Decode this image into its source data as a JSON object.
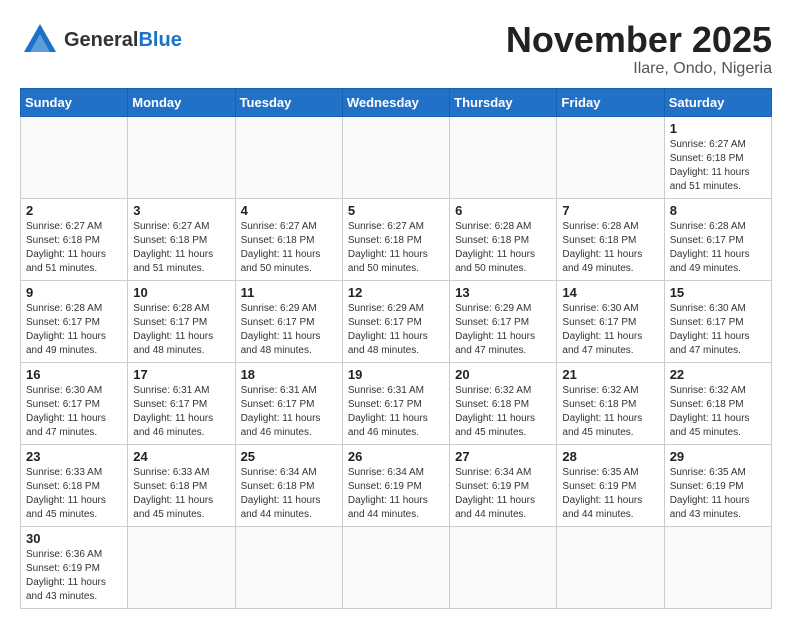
{
  "header": {
    "logo": {
      "general": "General",
      "blue": "Blue"
    },
    "title": "November 2025",
    "location": "Ilare, Ondo, Nigeria"
  },
  "weekdays": [
    "Sunday",
    "Monday",
    "Tuesday",
    "Wednesday",
    "Thursday",
    "Friday",
    "Saturday"
  ],
  "weeks": [
    [
      null,
      null,
      null,
      null,
      null,
      null,
      {
        "day": "1",
        "sunrise": "6:27 AM",
        "sunset": "6:18 PM",
        "daylight": "11 hours and 51 minutes."
      }
    ],
    [
      {
        "day": "2",
        "sunrise": "6:27 AM",
        "sunset": "6:18 PM",
        "daylight": "11 hours and 51 minutes."
      },
      {
        "day": "3",
        "sunrise": "6:27 AM",
        "sunset": "6:18 PM",
        "daylight": "11 hours and 51 minutes."
      },
      {
        "day": "4",
        "sunrise": "6:27 AM",
        "sunset": "6:18 PM",
        "daylight": "11 hours and 50 minutes."
      },
      {
        "day": "5",
        "sunrise": "6:27 AM",
        "sunset": "6:18 PM",
        "daylight": "11 hours and 50 minutes."
      },
      {
        "day": "6",
        "sunrise": "6:28 AM",
        "sunset": "6:18 PM",
        "daylight": "11 hours and 50 minutes."
      },
      {
        "day": "7",
        "sunrise": "6:28 AM",
        "sunset": "6:18 PM",
        "daylight": "11 hours and 49 minutes."
      },
      {
        "day": "8",
        "sunrise": "6:28 AM",
        "sunset": "6:17 PM",
        "daylight": "11 hours and 49 minutes."
      }
    ],
    [
      {
        "day": "9",
        "sunrise": "6:28 AM",
        "sunset": "6:17 PM",
        "daylight": "11 hours and 49 minutes."
      },
      {
        "day": "10",
        "sunrise": "6:28 AM",
        "sunset": "6:17 PM",
        "daylight": "11 hours and 48 minutes."
      },
      {
        "day": "11",
        "sunrise": "6:29 AM",
        "sunset": "6:17 PM",
        "daylight": "11 hours and 48 minutes."
      },
      {
        "day": "12",
        "sunrise": "6:29 AM",
        "sunset": "6:17 PM",
        "daylight": "11 hours and 48 minutes."
      },
      {
        "day": "13",
        "sunrise": "6:29 AM",
        "sunset": "6:17 PM",
        "daylight": "11 hours and 47 minutes."
      },
      {
        "day": "14",
        "sunrise": "6:30 AM",
        "sunset": "6:17 PM",
        "daylight": "11 hours and 47 minutes."
      },
      {
        "day": "15",
        "sunrise": "6:30 AM",
        "sunset": "6:17 PM",
        "daylight": "11 hours and 47 minutes."
      }
    ],
    [
      {
        "day": "16",
        "sunrise": "6:30 AM",
        "sunset": "6:17 PM",
        "daylight": "11 hours and 47 minutes."
      },
      {
        "day": "17",
        "sunrise": "6:31 AM",
        "sunset": "6:17 PM",
        "daylight": "11 hours and 46 minutes."
      },
      {
        "day": "18",
        "sunrise": "6:31 AM",
        "sunset": "6:17 PM",
        "daylight": "11 hours and 46 minutes."
      },
      {
        "day": "19",
        "sunrise": "6:31 AM",
        "sunset": "6:17 PM",
        "daylight": "11 hours and 46 minutes."
      },
      {
        "day": "20",
        "sunrise": "6:32 AM",
        "sunset": "6:18 PM",
        "daylight": "11 hours and 45 minutes."
      },
      {
        "day": "21",
        "sunrise": "6:32 AM",
        "sunset": "6:18 PM",
        "daylight": "11 hours and 45 minutes."
      },
      {
        "day": "22",
        "sunrise": "6:32 AM",
        "sunset": "6:18 PM",
        "daylight": "11 hours and 45 minutes."
      }
    ],
    [
      {
        "day": "23",
        "sunrise": "6:33 AM",
        "sunset": "6:18 PM",
        "daylight": "11 hours and 45 minutes."
      },
      {
        "day": "24",
        "sunrise": "6:33 AM",
        "sunset": "6:18 PM",
        "daylight": "11 hours and 45 minutes."
      },
      {
        "day": "25",
        "sunrise": "6:34 AM",
        "sunset": "6:18 PM",
        "daylight": "11 hours and 44 minutes."
      },
      {
        "day": "26",
        "sunrise": "6:34 AM",
        "sunset": "6:19 PM",
        "daylight": "11 hours and 44 minutes."
      },
      {
        "day": "27",
        "sunrise": "6:34 AM",
        "sunset": "6:19 PM",
        "daylight": "11 hours and 44 minutes."
      },
      {
        "day": "28",
        "sunrise": "6:35 AM",
        "sunset": "6:19 PM",
        "daylight": "11 hours and 44 minutes."
      },
      {
        "day": "29",
        "sunrise": "6:35 AM",
        "sunset": "6:19 PM",
        "daylight": "11 hours and 43 minutes."
      }
    ],
    [
      {
        "day": "30",
        "sunrise": "6:36 AM",
        "sunset": "6:19 PM",
        "daylight": "11 hours and 43 minutes."
      },
      null,
      null,
      null,
      null,
      null,
      null
    ]
  ],
  "labels": {
    "sunrise": "Sunrise:",
    "sunset": "Sunset:",
    "daylight": "Daylight:"
  }
}
